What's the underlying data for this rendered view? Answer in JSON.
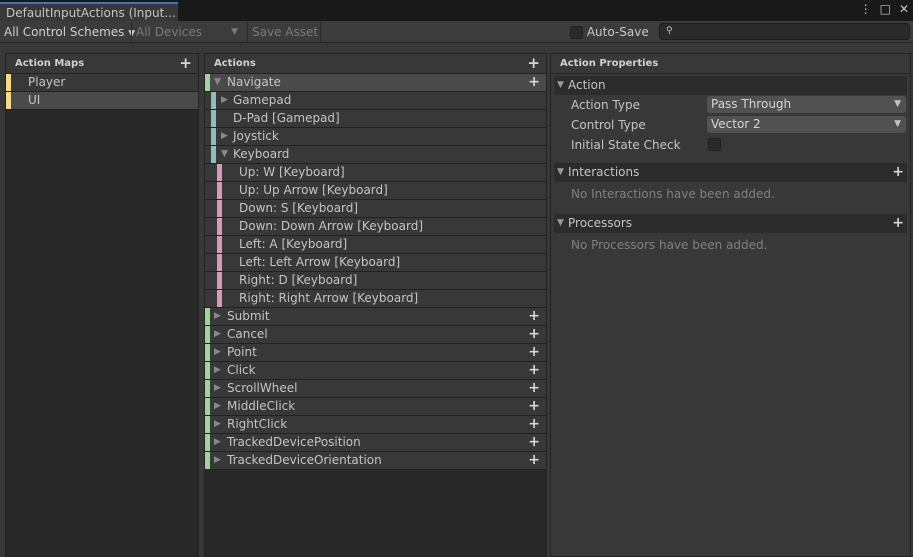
{
  "window": {
    "tab_title": "DefaultInputActions (Input...",
    "menu_icon": "⋮",
    "maximize_icon": "□",
    "close_icon": "✕"
  },
  "toolbar": {
    "control_schemes": "All Control Schemes",
    "devices": "All Devices",
    "save_asset": "Save Asset",
    "auto_save": "Auto-Save",
    "search_placeholder": ""
  },
  "action_maps": {
    "header": "Action Maps",
    "items": [
      {
        "label": "Player",
        "selected": false
      },
      {
        "label": "UI",
        "selected": true
      }
    ]
  },
  "actions": {
    "header": "Actions",
    "items": [
      {
        "label": "Navigate",
        "kind": "action",
        "expanded": true,
        "selected": true
      },
      {
        "label": "Gamepad",
        "kind": "composite",
        "expanded": false
      },
      {
        "label": "D-Pad [Gamepad]",
        "kind": "binding"
      },
      {
        "label": "Joystick",
        "kind": "composite",
        "expanded": false
      },
      {
        "label": "Keyboard",
        "kind": "composite",
        "expanded": true
      },
      {
        "label": "Up: W [Keyboard]",
        "kind": "part"
      },
      {
        "label": "Up: Up Arrow [Keyboard]",
        "kind": "part"
      },
      {
        "label": "Down: S [Keyboard]",
        "kind": "part"
      },
      {
        "label": "Down: Down Arrow [Keyboard]",
        "kind": "part"
      },
      {
        "label": "Left: A [Keyboard]",
        "kind": "part"
      },
      {
        "label": "Left: Left Arrow [Keyboard]",
        "kind": "part"
      },
      {
        "label": "Right: D [Keyboard]",
        "kind": "part"
      },
      {
        "label": "Right: Right Arrow [Keyboard]",
        "kind": "part"
      },
      {
        "label": "Submit",
        "kind": "action",
        "expanded": false
      },
      {
        "label": "Cancel",
        "kind": "action",
        "expanded": false
      },
      {
        "label": "Point",
        "kind": "action",
        "expanded": false
      },
      {
        "label": "Click",
        "kind": "action",
        "expanded": false
      },
      {
        "label": "ScrollWheel",
        "kind": "action",
        "expanded": false
      },
      {
        "label": "MiddleClick",
        "kind": "action",
        "expanded": false
      },
      {
        "label": "RightClick",
        "kind": "action",
        "expanded": false
      },
      {
        "label": "TrackedDevicePosition",
        "kind": "action",
        "expanded": false
      },
      {
        "label": "TrackedDeviceOrientation",
        "kind": "action",
        "expanded": false
      }
    ]
  },
  "properties": {
    "header": "Action Properties",
    "action_section": "Action",
    "action_type_label": "Action Type",
    "action_type_value": "Pass Through",
    "control_type_label": "Control Type",
    "control_type_value": "Vector 2",
    "initial_state_label": "Initial State Check",
    "interactions_section": "Interactions",
    "interactions_empty": "No Interactions have been added.",
    "processors_section": "Processors",
    "processors_empty": "No Processors have been added."
  },
  "colors": {
    "map": "#f4d98a",
    "action": "#a3d39c",
    "composite": "#8fbcbc",
    "part": "#d49cb8",
    "accent": "#3a79bb"
  }
}
